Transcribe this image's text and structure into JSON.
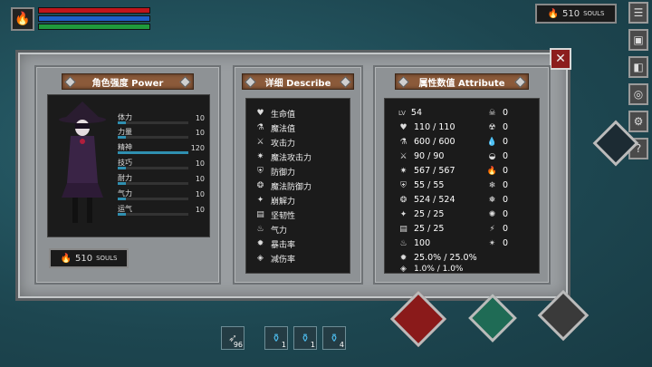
{
  "hud": {
    "souls": "510",
    "souls_unit": "SOULS"
  },
  "power_panel": {
    "title": "角色强度 Power",
    "stats": [
      {
        "label": "体力",
        "value": "10"
      },
      {
        "label": "力量",
        "value": "10"
      },
      {
        "label": "精神",
        "value": "120"
      },
      {
        "label": "技巧",
        "value": "10"
      },
      {
        "label": "耐力",
        "value": "10"
      },
      {
        "label": "气力",
        "value": "10"
      },
      {
        "label": "运气",
        "value": "10"
      }
    ],
    "souls": "510",
    "souls_unit": "SOULS"
  },
  "describe_panel": {
    "title": "详细 Describe",
    "items": [
      "生命值",
      "魔法值",
      "攻击力",
      "魔法攻击力",
      "防御力",
      "魔法防御力",
      "崩解力",
      "坚韧性",
      "气力",
      "暴击率",
      "减伤率"
    ]
  },
  "attribute_panel": {
    "title": "属性数值 Attribute",
    "left": [
      "54",
      "110 / 110",
      "600 / 600",
      "90 / 90",
      "567 / 567",
      "55 / 55",
      "524 / 524",
      "25 / 25",
      "25 / 25",
      "100",
      "25.0% / 25.0%",
      "1.0% / 1.0%"
    ],
    "left_tag": "LV",
    "right": [
      "0",
      "0",
      "0",
      "0",
      "0",
      "0",
      "0",
      "0",
      "0",
      "0"
    ]
  },
  "bottom": {
    "arrows": "96",
    "potion1": "1",
    "potion2": "1",
    "potion3": "4"
  },
  "colors": {
    "health": "#c0151b",
    "mana": "#1e5fc8",
    "stamina": "#1f9a3c",
    "title_bar": "#8b5a3a"
  }
}
